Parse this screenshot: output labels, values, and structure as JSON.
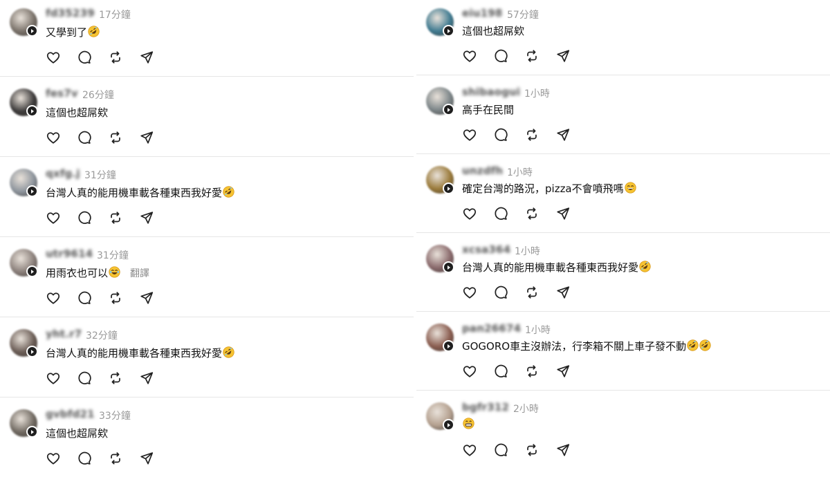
{
  "left": [
    {
      "username": "fd35239",
      "time": "17分鐘",
      "text": "又學到了",
      "emoji": "rofl",
      "translate": "",
      "avatar": "#7a726a"
    },
    {
      "username": "fes7v",
      "time": "26分鐘",
      "text": "這個也超屌欸",
      "emoji": "",
      "translate": "",
      "avatar": "#3c3a3a"
    },
    {
      "username": "qxfg.j",
      "time": "31分鐘",
      "text": "台灣人真的能用機車載各種東西我好愛",
      "emoji": "rofl",
      "translate": "",
      "avatar": "#8d949c"
    },
    {
      "username": "utr9614",
      "time": "31分鐘",
      "text": "用雨衣也可以",
      "emoji": "joy",
      "translate": "翻譯",
      "avatar": "#8a7f7a"
    },
    {
      "username": "yht.r7",
      "time": "32分鐘",
      "text": "台灣人真的能用機車載各種東西我好愛",
      "emoji": "rofl",
      "translate": "",
      "avatar": "#6a5c55"
    },
    {
      "username": "gvbfd21",
      "time": "33分鐘",
      "text": "這個也超屌欸",
      "emoji": "",
      "translate": "",
      "avatar": "#6f6860"
    }
  ],
  "right": [
    {
      "username": "eiu198",
      "time": "57分鐘",
      "text": "這個也超屌欸",
      "emoji": "",
      "translate": "",
      "avatar": "#3f7a90"
    },
    {
      "username": "shibaogui",
      "time": "1小時",
      "text": "高手在民間",
      "emoji": "",
      "translate": "",
      "avatar": "#7c8588"
    },
    {
      "username": "unzdfh",
      "time": "1小時",
      "text": "確定台灣的路況，pizza不會噴飛嗎",
      "emoji": "laugh",
      "translate": "",
      "avatar": "#9a7a3a"
    },
    {
      "username": "xcsa364",
      "time": "1小時",
      "text": "台灣人真的能用機車載各種東西我好愛",
      "emoji": "rofl",
      "translate": "",
      "avatar": "#8a6a6c"
    },
    {
      "username": "pan26674",
      "time": "1小時",
      "text": "GOGORO車主沒辦法，行李箱不關上車子發不動",
      "emoji": "rofl2",
      "translate": "",
      "avatar": "#8a5d50"
    },
    {
      "username": "bgfr312",
      "time": "2小時",
      "text": "",
      "emoji": "grin",
      "translate": "",
      "avatar": "#b4a08f"
    }
  ],
  "icons": {
    "like": "heart-icon",
    "reply": "comment-icon",
    "repost": "repost-icon",
    "share": "send-icon"
  }
}
